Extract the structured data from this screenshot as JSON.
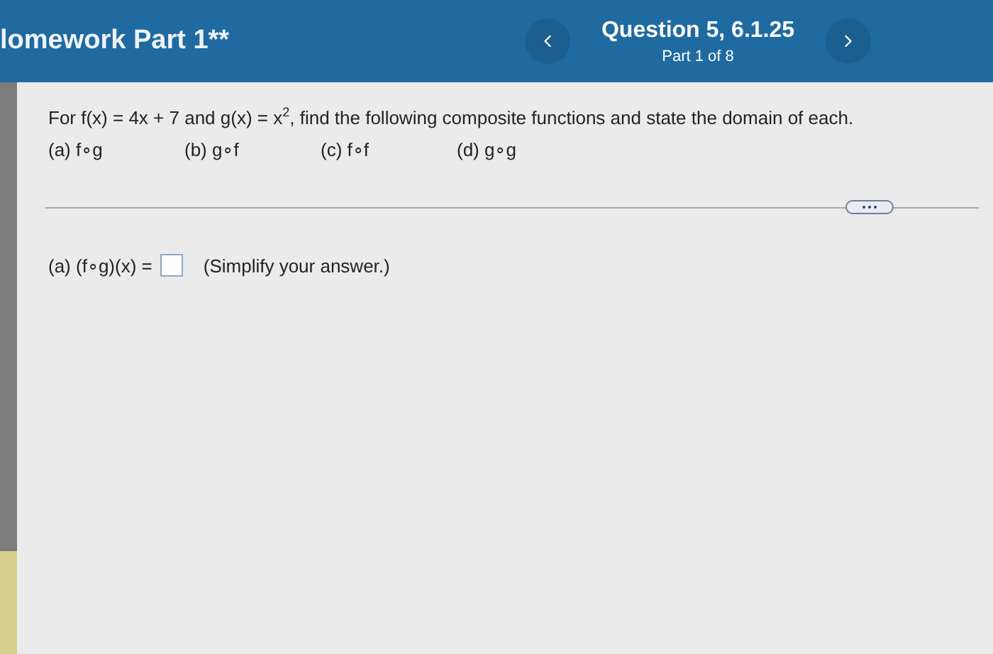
{
  "header": {
    "title": "lomework Part 1**",
    "question": "Question 5, 6.1.25",
    "part": "Part 1 of 8"
  },
  "problem": {
    "statement": "For f(x) = 4x + 7 and g(x) = x$^{2}$, find the following composite functions and state the domain of each.",
    "parts": [
      "(a) f∘g",
      "(b) g∘f",
      "(c) f∘f",
      "(d) g∘g"
    ]
  },
  "answer": {
    "label": "(a) (f∘g)(x) =",
    "hint": "(Simplify your answer.)"
  }
}
